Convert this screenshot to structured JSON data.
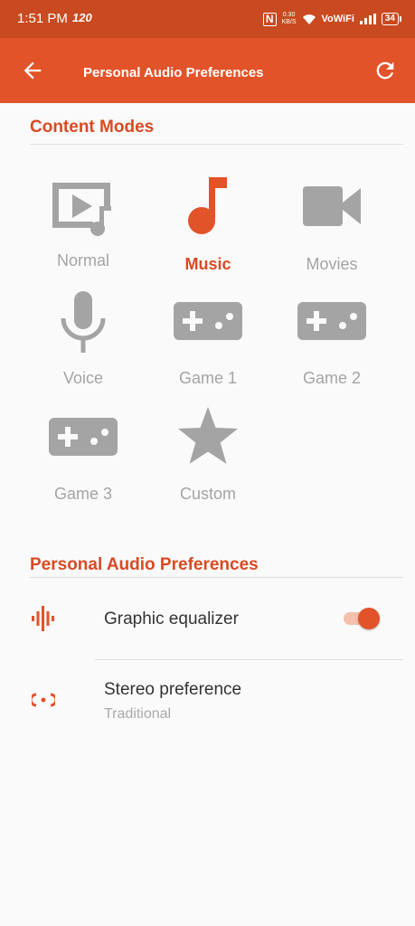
{
  "status_bar": {
    "time": "1:51 PM",
    "refresh_rate": "120",
    "nfc": "N",
    "net_speed_value": "0.30",
    "net_speed_unit": "KB/S",
    "vowifi": "VoWiFi",
    "battery": "34"
  },
  "app_bar": {
    "title": "Personal Audio Preferences",
    "back_icon": "arrow-back-icon",
    "refresh_icon": "refresh-icon"
  },
  "content_modes": {
    "heading": "Content Modes",
    "selected": "Music",
    "modes": [
      {
        "label": "Normal",
        "icon": "video-music-icon"
      },
      {
        "label": "Music",
        "icon": "music-note-icon"
      },
      {
        "label": "Movies",
        "icon": "videocam-icon"
      },
      {
        "label": "Voice",
        "icon": "microphone-icon"
      },
      {
        "label": "Game 1",
        "icon": "gamepad-icon"
      },
      {
        "label": "Game 2",
        "icon": "gamepad-icon"
      },
      {
        "label": "Game 3",
        "icon": "gamepad-icon"
      },
      {
        "label": "Custom",
        "icon": "star-icon"
      }
    ]
  },
  "preferences": {
    "heading": "Personal Audio Preferences",
    "equalizer": {
      "title": "Graphic equalizer",
      "enabled": true,
      "icon": "equalizer-icon"
    },
    "stereo": {
      "title": "Stereo preference",
      "subtitle": "Traditional",
      "icon": "stereo-icon"
    }
  },
  "colors": {
    "accent": "#e2532a",
    "status_bar": "#c94a20",
    "inactive_icon": "#a4a4a4"
  }
}
